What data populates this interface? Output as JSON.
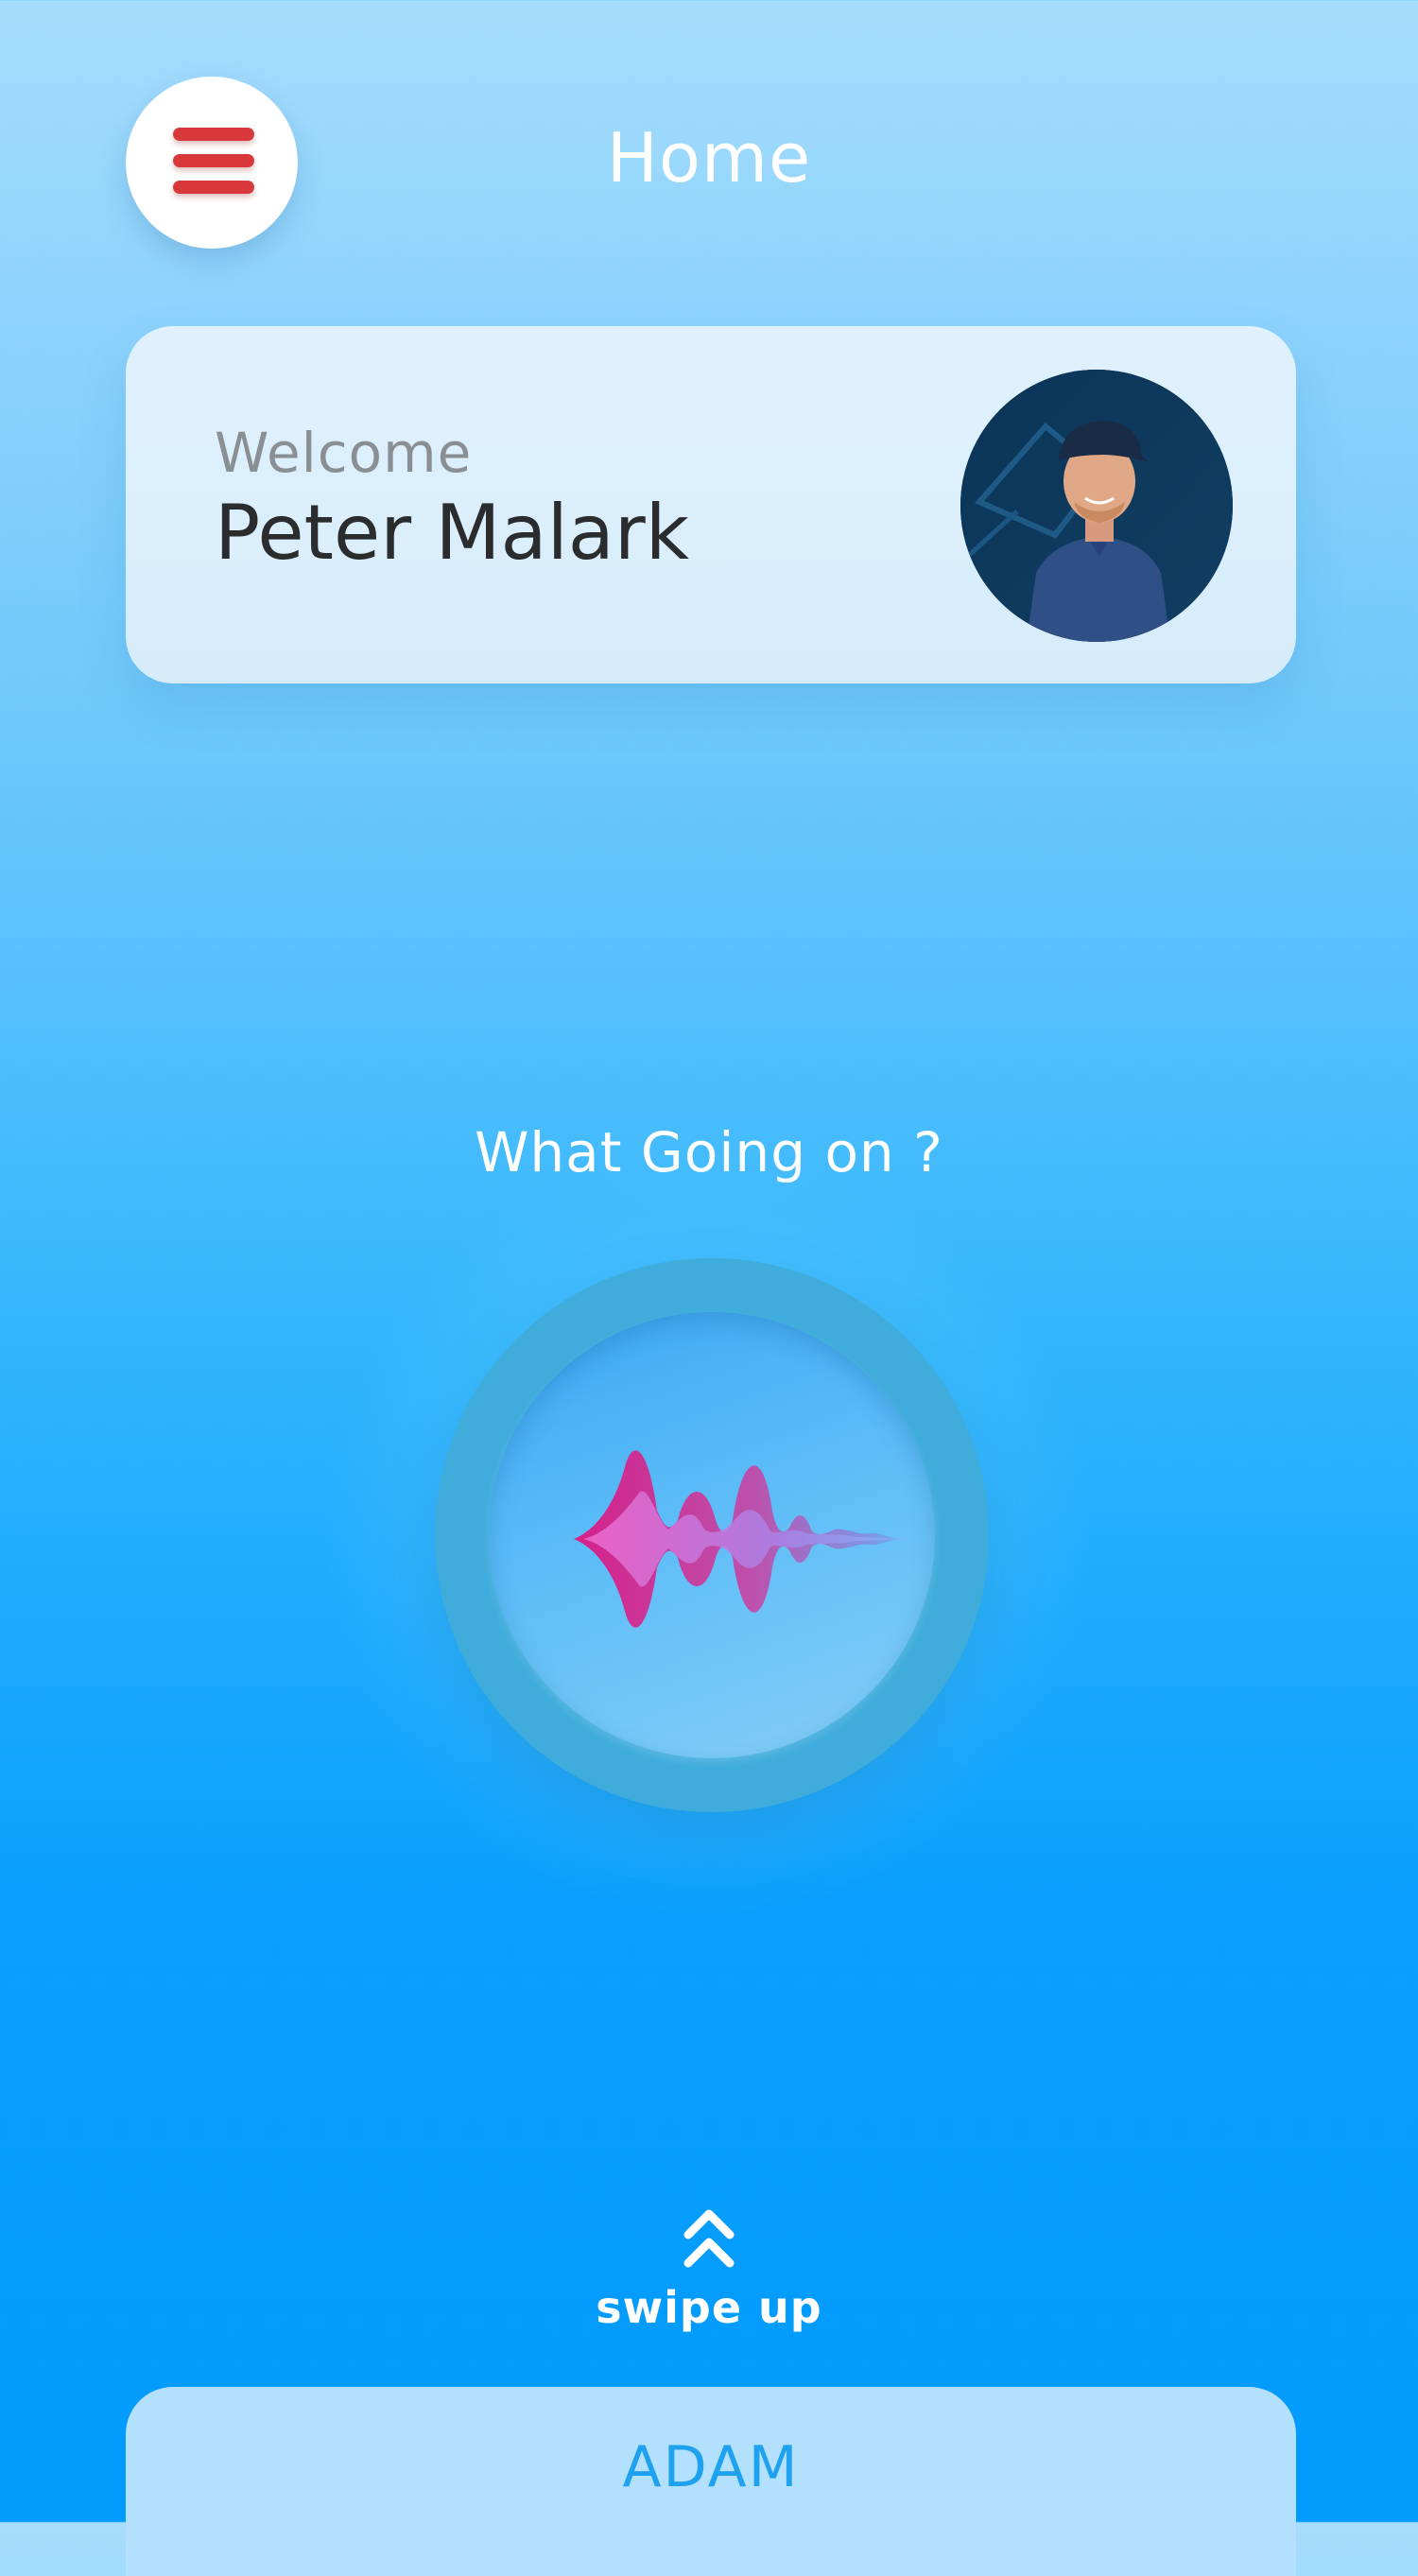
{
  "header": {
    "title": "Home",
    "menu_icon": "hamburger-menu-icon"
  },
  "welcome_card": {
    "greeting": "Welcome",
    "user_name": "Peter Malark",
    "avatar": "user-avatar-photo"
  },
  "main": {
    "prompt": "What Going on ?",
    "voice_icon": "sound-wave-icon"
  },
  "swipe": {
    "icon": "double-chevron-up-icon",
    "label": "swipe up"
  },
  "bottom_card": {
    "label": "ADAM"
  },
  "colors": {
    "menu_icon": "#d9383b",
    "wave_start": "#e0137f",
    "wave_end": "#6ca8f5",
    "accent_text": "#1ea1ef"
  }
}
